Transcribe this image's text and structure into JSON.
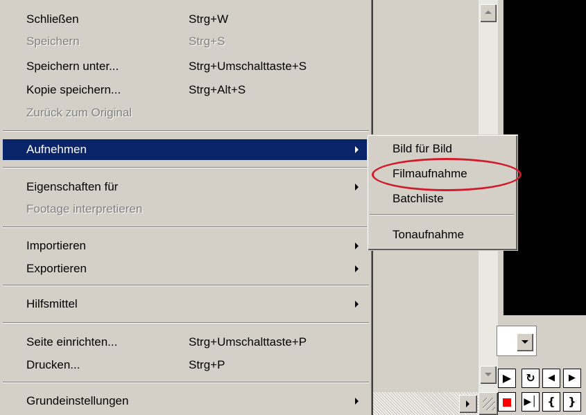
{
  "file_menu": {
    "items": [
      {
        "label": "Schließen",
        "shortcut": "Strg+W",
        "disabled": false
      },
      {
        "label": "Speichern",
        "shortcut": "Strg+S",
        "disabled": true
      },
      {
        "label": "Speichern unter...",
        "shortcut": "Strg+Umschalttaste+S",
        "disabled": false
      },
      {
        "label": "Kopie speichern...",
        "shortcut": "Strg+Alt+S",
        "disabled": false
      },
      {
        "label": "Zurück zum Original",
        "shortcut": "",
        "disabled": true
      },
      {
        "label": "Aufnehmen",
        "shortcut": "",
        "disabled": false,
        "submenu": true,
        "selected": true
      },
      {
        "label": "Eigenschaften für",
        "shortcut": "",
        "disabled": false,
        "submenu": true
      },
      {
        "label": "Footage interpretieren",
        "shortcut": "",
        "disabled": true
      },
      {
        "label": "Importieren",
        "shortcut": "",
        "disabled": false,
        "submenu": true
      },
      {
        "label": "Exportieren",
        "shortcut": "",
        "disabled": false,
        "submenu": true
      },
      {
        "label": "Hilfsmittel",
        "shortcut": "",
        "disabled": false,
        "submenu": true
      },
      {
        "label": "Seite einrichten...",
        "shortcut": "Strg+Umschalttaste+P",
        "disabled": false
      },
      {
        "label": "Drucken...",
        "shortcut": "Strg+P",
        "disabled": false
      },
      {
        "label": "Grundeinstellungen",
        "shortcut": "",
        "disabled": false,
        "submenu": true
      }
    ]
  },
  "capture_submenu": {
    "items": [
      {
        "label": "Bild für Bild"
      },
      {
        "label": "Filmaufnahme",
        "highlighted_by_annotation": true
      },
      {
        "label": "Batchliste"
      },
      {
        "label": "Tonaufnahme"
      }
    ]
  },
  "annotation": {
    "color": "#d11a2a",
    "shape": "ellipse"
  },
  "colors": {
    "menu_bg": "#d4d0c8",
    "selection": "#0a246a",
    "disabled_text": "#808080",
    "record": "#ff0000"
  },
  "icons": {
    "scroll_up": "triangle-up",
    "scroll_down": "triangle-down",
    "scroll_right": "triangle-right",
    "dropdown": "triangle-down",
    "transport": [
      "play-icon",
      "loop-icon",
      "step-back-icon",
      "step-forward-icon",
      "record-icon",
      "go-to-end-icon",
      "set-in-point-icon",
      "set-out-point-icon"
    ]
  }
}
